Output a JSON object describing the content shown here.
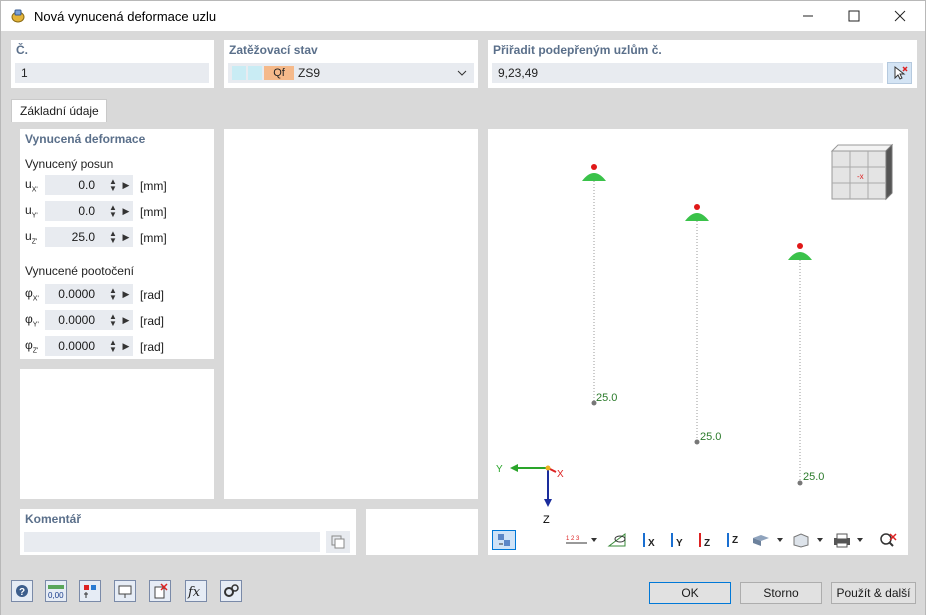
{
  "window": {
    "title": "Nová vynucená deformace uzlu"
  },
  "number": {
    "label": "Č.",
    "value": "1"
  },
  "load_case": {
    "label": "Zatěžovací stav",
    "tag": "Qf",
    "value": "ZS9"
  },
  "assign": {
    "label": "Přiřadit podepřeným uzlům č.",
    "value": "9,23,49"
  },
  "tab": {
    "label": "Základní údaje"
  },
  "deformation": {
    "title": "Vynucená deformace",
    "displacement_title": "Vynucený posun",
    "rotation_title": "Vynucené pootočení",
    "displacements": [
      {
        "sym": "u",
        "sub": "X'",
        "value": "0.0",
        "unit": "[mm]"
      },
      {
        "sym": "u",
        "sub": "Y'",
        "value": "0.0",
        "unit": "[mm]"
      },
      {
        "sym": "u",
        "sub": "Z'",
        "value": "25.0",
        "unit": "[mm]"
      }
    ],
    "rotations": [
      {
        "sym": "φ",
        "sub": "X'",
        "value": "0.0000",
        "unit": "[rad]"
      },
      {
        "sym": "φ",
        "sub": "Y'",
        "value": "0.0000",
        "unit": "[rad]"
      },
      {
        "sym": "φ",
        "sub": "Z'",
        "value": "0.0000",
        "unit": "[rad]"
      }
    ]
  },
  "comment": {
    "label": "Komentář",
    "value": ""
  },
  "view": {
    "labels": [
      "25.0",
      "25.0",
      "25.0"
    ],
    "axis_y": "Y",
    "axis_x": "X",
    "axis_z": "Z",
    "toolbar_axes": [
      "X",
      "Y",
      "Z",
      "Z"
    ]
  },
  "buttons": {
    "ok": "OK",
    "cancel": "Storno",
    "apply_next": "Použít & další"
  },
  "icons": [
    "help-icon",
    "units-icon",
    "display-icon",
    "view-icon",
    "delete-icon",
    "formula-icon",
    "settings-icon"
  ],
  "colors": {
    "accent": "#0078d7",
    "label": "#5a6f8a",
    "support": "#33b34a",
    "tag": "#f5b98a"
  }
}
